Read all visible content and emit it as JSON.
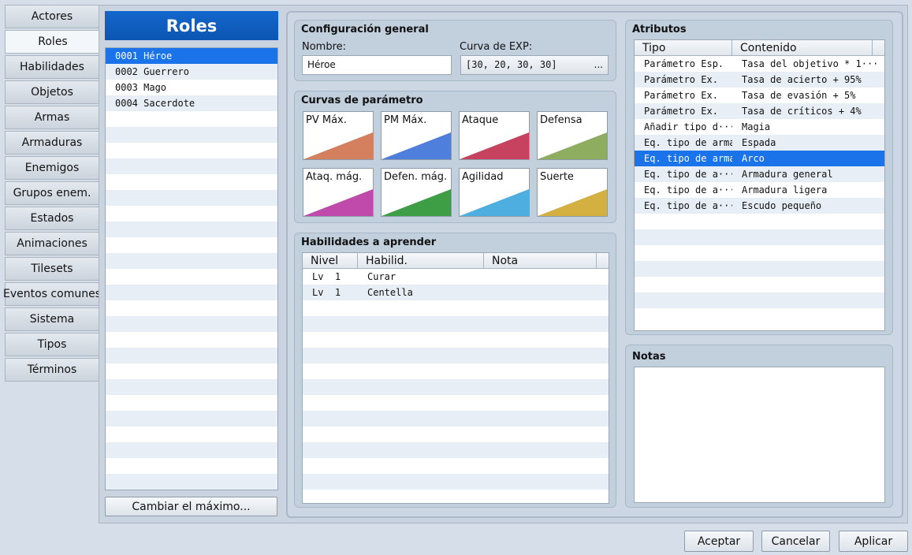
{
  "nav": {
    "items": [
      {
        "label": "Actores"
      },
      {
        "label": "Roles"
      },
      {
        "label": "Habilidades"
      },
      {
        "label": "Objetos"
      },
      {
        "label": "Armas"
      },
      {
        "label": "Armaduras"
      },
      {
        "label": "Enemigos"
      },
      {
        "label": "Grupos enem."
      },
      {
        "label": "Estados"
      },
      {
        "label": "Animaciones"
      },
      {
        "label": "Tilesets"
      },
      {
        "label": "Eventos comunes"
      },
      {
        "label": "Sistema"
      },
      {
        "label": "Tipos"
      },
      {
        "label": "Términos"
      }
    ],
    "active_index": 1
  },
  "roles": {
    "header": "Roles",
    "items": [
      "0001 Héroe",
      "0002 Guerrero",
      "0003 Mago",
      "0004 Sacerdote"
    ],
    "selected_index": 0,
    "change_max_label": "Cambiar el máximo..."
  },
  "general": {
    "title": "Configuración general",
    "name_label": "Nombre:",
    "name_value": "Héroe",
    "exp_label": "Curva de EXP:",
    "exp_value": "[30, 20, 30, 30]",
    "exp_button": "..."
  },
  "curves": {
    "title": "Curvas de parámetro",
    "tiles": [
      {
        "label": "PV Máx.",
        "color": "#d4805e"
      },
      {
        "label": "PM Máx.",
        "color": "#4f7fdc"
      },
      {
        "label": "Ataque",
        "color": "#c6425e"
      },
      {
        "label": "Defensa",
        "color": "#8fad5e"
      },
      {
        "label": "Ataq. mág.",
        "color": "#c04aac"
      },
      {
        "label": "Defen. mág.",
        "color": "#3e9e46"
      },
      {
        "label": "Agilidad",
        "color": "#4eaee0"
      },
      {
        "label": "Suerte",
        "color": "#d4b040"
      }
    ]
  },
  "skills": {
    "title": "Habilidades a aprender",
    "columns": [
      "Nivel",
      "Habilid.",
      "Nota"
    ],
    "rows": [
      {
        "level": "Lv  1",
        "skill": "Curar",
        "note": ""
      },
      {
        "level": "Lv  1",
        "skill": "Centella",
        "note": ""
      }
    ]
  },
  "traits": {
    "title": "Atributos",
    "columns": [
      "Tipo",
      "Contenido"
    ],
    "rows": [
      {
        "type": "Parámetro Esp.",
        "content": "Tasa del objetivo * 1···"
      },
      {
        "type": "Parámetro Ex.",
        "content": "Tasa de acierto + 95%"
      },
      {
        "type": "Parámetro Ex.",
        "content": "Tasa de evasión + 5%"
      },
      {
        "type": "Parámetro Ex.",
        "content": "Tasa de críticos + 4%"
      },
      {
        "type": "Añadir tipo d···",
        "content": "Magia"
      },
      {
        "type": "Eq. tipo de arma",
        "content": "Espada"
      },
      {
        "type": "Eq. tipo de arma",
        "content": "Arco"
      },
      {
        "type": "Eq. tipo de a···",
        "content": "Armadura general"
      },
      {
        "type": "Eq. tipo de a···",
        "content": "Armadura ligera"
      },
      {
        "type": "Eq. tipo de a···",
        "content": "Escudo pequeño"
      }
    ],
    "selected_index": 6
  },
  "notes": {
    "title": "Notas",
    "value": ""
  },
  "footer": {
    "accept": "Aceptar",
    "cancel": "Cancelar",
    "apply": "Aplicar"
  },
  "colors": {
    "selection": "#1a73e8",
    "header_blue": "#0b56b3"
  }
}
